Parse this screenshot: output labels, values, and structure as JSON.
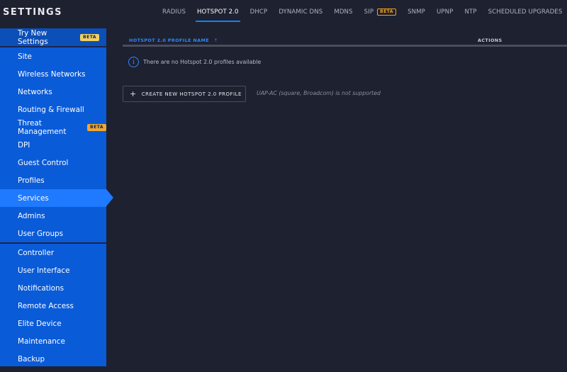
{
  "app_title": "SETTINGS",
  "tabs": [
    {
      "label": "RADIUS",
      "active": false
    },
    {
      "label": "HOTSPOT 2.0",
      "active": true
    },
    {
      "label": "DHCP",
      "active": false
    },
    {
      "label": "DYNAMIC DNS",
      "active": false
    },
    {
      "label": "MDNS",
      "active": false
    },
    {
      "label": "SIP",
      "badge": "BETA",
      "active": false
    },
    {
      "label": "SNMP",
      "active": false
    },
    {
      "label": "UPNP",
      "active": false
    },
    {
      "label": "NTP",
      "active": false
    },
    {
      "label": "SCHEDULED UPGRADES",
      "active": false
    }
  ],
  "sidebar": {
    "top": {
      "label": "Try New Settings",
      "badge": "BETA"
    },
    "site_items": [
      {
        "label": "Site"
      },
      {
        "label": "Wireless Networks"
      },
      {
        "label": "Networks"
      },
      {
        "label": "Routing & Firewall"
      },
      {
        "label": "Threat Management",
        "badge": "BETA"
      },
      {
        "label": "DPI"
      },
      {
        "label": "Guest Control"
      },
      {
        "label": "Profiles"
      },
      {
        "label": "Services",
        "active": true
      },
      {
        "label": "Admins"
      },
      {
        "label": "User Groups"
      }
    ],
    "controller_items": [
      {
        "label": "Controller"
      },
      {
        "label": "User Interface"
      },
      {
        "label": "Notifications"
      },
      {
        "label": "Remote Access"
      },
      {
        "label": "Elite Device"
      },
      {
        "label": "Maintenance"
      },
      {
        "label": "Backup"
      }
    ]
  },
  "table": {
    "col_name": "HOTSPOT 2.0 PROFILE NAME",
    "sort_indicator": "↑",
    "col_actions": "ACTIONS",
    "empty_message": "There are no Hotspot 2.0 profiles available",
    "empty_icon": "info-icon"
  },
  "create_button": {
    "icon": "plus-icon",
    "label": "CREATE NEW HOTSPOT 2.0 PROFILE"
  },
  "note": "UAP-AC (square, Broadcom) is not supported",
  "colors": {
    "background": "#1e2130",
    "sidebar": "#0a5bd8",
    "sidebar_active": "#1f7aff",
    "accent": "#2f86ff",
    "badge": "#f0a020"
  }
}
